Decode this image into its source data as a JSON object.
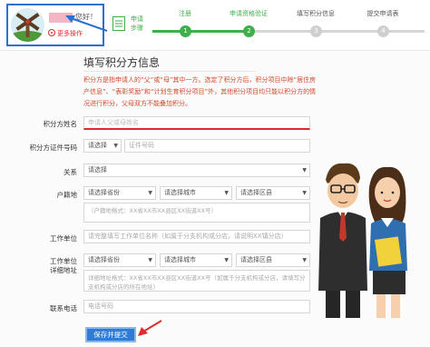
{
  "header": {
    "greeting": "您好！",
    "more_ops": "更多操作",
    "apply_steps": "申请步骤",
    "steps": [
      {
        "label": "注册",
        "num": "1",
        "state": "done"
      },
      {
        "label": "申请资格验证",
        "num": "2",
        "state": "current"
      },
      {
        "label": "填写积分信息",
        "num": "3",
        "state": "todo"
      },
      {
        "label": "提交申请表",
        "num": "4",
        "state": "todo"
      }
    ]
  },
  "form": {
    "title": "填写积分方信息",
    "notice": "积分方是指申请人的“父”或“母”其中一方。选定了积分方后，积分项目中除“居住房产信息”、“表彰奖励”和“计划生育积分项目”外，其他积分项目均只能以积分方的情况进行积分，父母双方不能叠加积分。",
    "name": {
      "label": "积分方姓名",
      "placeholder": "申请人父或母姓名"
    },
    "id_no": {
      "label": "积分方证件号码",
      "type_value": "请选择",
      "placeholder": "证件号码"
    },
    "relation": {
      "label": "关系",
      "value": "请选择"
    },
    "hukou": {
      "label": "户籍地",
      "province": "请选择省份",
      "city": "请选择城市",
      "district": "请选择区县",
      "detail_placeholder": "（户籍地格式：XX省XX市XX县区XX街道XX号）"
    },
    "employer": {
      "label": "工作单位",
      "placeholder": "请完整填写工作单位名称（如属于分支机构或分店，请说明XX镇分店）"
    },
    "work_addr": {
      "label": "工作单位",
      "label2": "详细地址",
      "province": "请选择省份",
      "city": "请选择城市",
      "district": "请选择区县",
      "detail_placeholder": "详细地址格式：XX省XX市XX县区XX街道XX号（如属于分支机构或分店，请填写分支机构或分店的所在地址）"
    },
    "phone": {
      "label": "联系电话",
      "placeholder": "电话号码"
    },
    "submit": "保存并提交"
  },
  "colors": {
    "accent": "#3eaf49",
    "primary": "#2f7bd8",
    "alert": "#e0292d"
  }
}
